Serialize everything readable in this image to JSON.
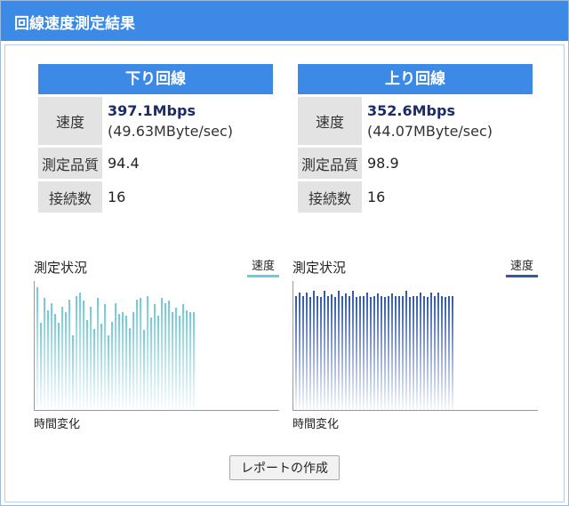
{
  "header": {
    "title": "回線速度測定結果"
  },
  "download": {
    "title": "下り回線",
    "speed_label": "速度",
    "speed_main": "397.1Mbps",
    "speed_sub": "(49.63MByte/sec)",
    "quality_label": "測定品質",
    "quality_value": "94.4",
    "connections_label": "接続数",
    "connections_value": "16"
  },
  "upload": {
    "title": "上り回線",
    "speed_label": "速度",
    "speed_main": "352.6Mbps",
    "speed_sub": "(44.07MByte/sec)",
    "quality_label": "測定品質",
    "quality_value": "98.9",
    "connections_label": "接続数",
    "connections_value": "16"
  },
  "colors": {
    "header_blue": "#3d8ae6",
    "download_bar": "#6ccbd9",
    "upload_bar": "#2e58a8"
  },
  "chart_data": [
    {
      "type": "bar",
      "title": "測定状況",
      "xlabel": "時間変化",
      "legend": [
        {
          "name": "速度",
          "color": "#6ccbd9"
        }
      ],
      "ylim": [
        0,
        1
      ],
      "series": [
        {
          "name": "速度",
          "values": [
            1.0,
            0.71,
            0.91,
            0.81,
            0.87,
            0.78,
            0.71,
            0.84,
            0.8,
            0.9,
            0.61,
            0.93,
            0.96,
            0.89,
            0.73,
            0.84,
            0.66,
            0.91,
            0.7,
            0.86,
            0.61,
            0.72,
            0.87,
            0.78,
            0.8,
            0.77,
            0.67,
            0.8,
            0.9,
            0.91,
            0.65,
            0.93,
            0.75,
            0.86,
            0.77,
            0.91,
            0.87,
            0.89,
            0.8,
            0.83,
            0.77,
            0.86,
            0.81,
            0.8,
            0.8
          ]
        }
      ]
    },
    {
      "type": "bar",
      "title": "測定状況",
      "xlabel": "時間変化",
      "legend": [
        {
          "name": "速度",
          "color": "#2e58a8"
        }
      ],
      "ylim": [
        0,
        1
      ],
      "series": [
        {
          "name": "速度",
          "values": [
            0.93,
            0.96,
            0.93,
            0.96,
            0.92,
            0.97,
            0.93,
            0.92,
            0.97,
            0.93,
            0.94,
            0.92,
            0.97,
            0.93,
            0.95,
            0.93,
            0.97,
            0.92,
            0.93,
            0.93,
            0.96,
            0.92,
            0.93,
            0.95,
            0.93,
            0.92,
            0.93,
            0.95,
            0.93,
            0.93,
            0.93,
            0.97,
            0.92,
            0.93,
            0.93,
            0.96,
            0.93,
            0.92,
            0.96,
            0.93,
            0.96,
            0.93,
            0.92,
            0.93,
            0.93
          ]
        }
      ]
    }
  ],
  "report_button": "レポートの作成"
}
